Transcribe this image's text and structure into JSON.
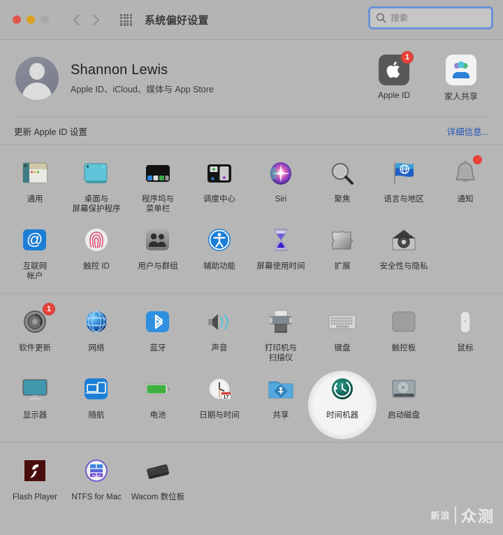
{
  "window": {
    "title": "系统偏好设置",
    "traffic_lights": [
      "close",
      "minimize",
      "zoom"
    ],
    "nav": {
      "back": "back-arrow",
      "forward": "forward-arrow"
    },
    "grid_icon": "show-all-grid-icon"
  },
  "search": {
    "placeholder": "搜索",
    "value": "",
    "icon": "search-icon"
  },
  "account": {
    "avatar": "user-avatar",
    "name": "Shannon Lewis",
    "subtitle": "Apple ID、iCloud、媒体与 App Store",
    "items": [
      {
        "label": "Apple ID",
        "icon": "apple-logo-icon",
        "badge": "1"
      },
      {
        "label": "家人共享",
        "icon": "family-sharing-icon",
        "badge": ""
      }
    ]
  },
  "update_banner": {
    "label": "更新 Apple ID 设置",
    "link": "详细信息..."
  },
  "sections": [
    {
      "name": "personal",
      "rows": [
        [
          {
            "label": "通用",
            "icon": "general-icon"
          },
          {
            "label": "桌面与\n屏幕保护程序",
            "icon": "desktop-screensaver-icon"
          },
          {
            "label": "程序坞与\n菜单栏",
            "icon": "dock-menubar-icon"
          },
          {
            "label": "调度中心",
            "icon": "mission-control-icon"
          },
          {
            "label": "Siri",
            "icon": "siri-icon"
          },
          {
            "label": "聚焦",
            "icon": "spotlight-icon"
          },
          {
            "label": "语言与地区",
            "icon": "language-region-icon"
          },
          {
            "label": "通知",
            "icon": "notifications-icon",
            "badge_dot": true
          }
        ],
        [
          {
            "label": "互联网\n帐户",
            "icon": "internet-accounts-icon"
          },
          {
            "label": "触控 ID",
            "icon": "touch-id-icon"
          },
          {
            "label": "用户与群组",
            "icon": "users-groups-icon"
          },
          {
            "label": "辅助功能",
            "icon": "accessibility-icon"
          },
          {
            "label": "屏幕使用时间",
            "icon": "screen-time-icon"
          },
          {
            "label": "扩展",
            "icon": "extensions-icon"
          },
          {
            "label": "安全性与隐私",
            "icon": "security-privacy-icon"
          }
        ]
      ]
    },
    {
      "name": "hardware",
      "rows": [
        [
          {
            "label": "软件更新",
            "icon": "software-update-icon",
            "badge": "1"
          },
          {
            "label": "网络",
            "icon": "network-icon"
          },
          {
            "label": "蓝牙",
            "icon": "bluetooth-icon"
          },
          {
            "label": "声音",
            "icon": "sound-icon"
          },
          {
            "label": "打印机与\n扫描仪",
            "icon": "printers-scanners-icon"
          },
          {
            "label": "键盘",
            "icon": "keyboard-icon"
          },
          {
            "label": "触控板",
            "icon": "trackpad-icon"
          },
          {
            "label": "鼠标",
            "icon": "mouse-icon"
          }
        ],
        [
          {
            "label": "显示器",
            "icon": "displays-icon"
          },
          {
            "label": "随航",
            "icon": "sidecar-icon"
          },
          {
            "label": "电池",
            "icon": "battery-icon"
          },
          {
            "label": "日期与时间",
            "icon": "date-time-icon",
            "day": "17",
            "month": "JUL"
          },
          {
            "label": "共享",
            "icon": "sharing-icon"
          },
          {
            "label": "时间机器",
            "icon": "time-machine-icon",
            "highlighted": true
          },
          {
            "label": "启动磁盘",
            "icon": "startup-disk-icon"
          }
        ]
      ]
    },
    {
      "name": "third-party",
      "rows": [
        [
          {
            "label": "Flash Player",
            "icon": "flash-player-icon"
          },
          {
            "label": "NTFS for Mac",
            "icon": "ntfs-for-mac-icon"
          },
          {
            "label": "Wacom 数位板",
            "icon": "wacom-tablet-icon"
          }
        ]
      ]
    }
  ],
  "watermark": {
    "left": "新浪",
    "right": "众测"
  },
  "colors": {
    "window_bg": "#b6b6b6",
    "titlebar_bg": "#b4b4b4",
    "accent_blue": "#2254b8",
    "focus_ring": "#6a93d4",
    "badge_red": "#e8433a",
    "divider": "#a8a8a8"
  }
}
